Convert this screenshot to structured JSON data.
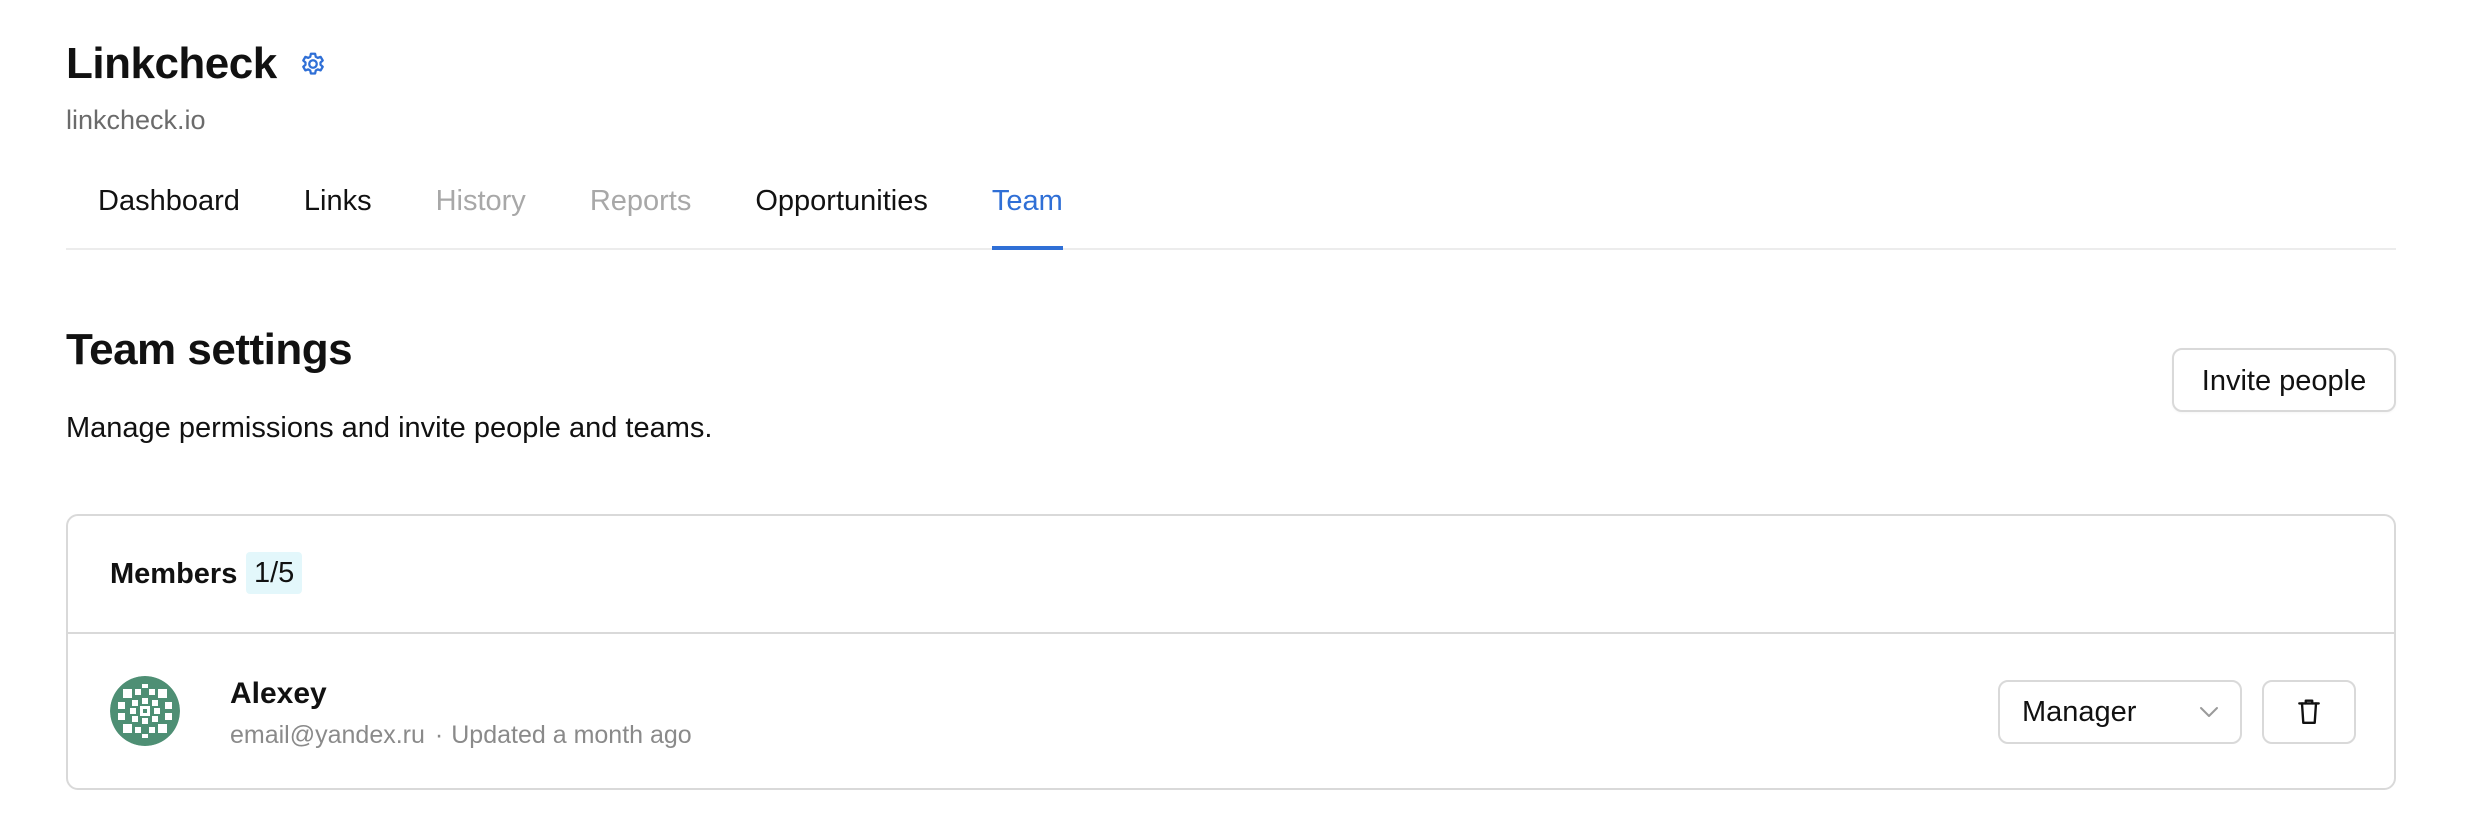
{
  "project": {
    "title": "Linkcheck",
    "domain": "linkcheck.io",
    "settings_icon": "gear-icon"
  },
  "tabs": [
    {
      "label": "Dashboard",
      "state": "normal"
    },
    {
      "label": "Links",
      "state": "normal"
    },
    {
      "label": "History",
      "state": "disabled"
    },
    {
      "label": "Reports",
      "state": "disabled"
    },
    {
      "label": "Opportunities",
      "state": "normal"
    },
    {
      "label": "Team",
      "state": "active"
    }
  ],
  "team": {
    "title": "Team settings",
    "description": "Manage permissions and invite people and teams.",
    "invite_label": "Invite people"
  },
  "members": {
    "title": "Members",
    "count": "1/5",
    "list": [
      {
        "name": "Alexey",
        "email": "email@yandex.ru",
        "separator": "·",
        "updated": "Updated a month ago",
        "role": "Manager",
        "avatar_icon": "identicon-avatar",
        "delete_icon": "trash-icon",
        "role_icon": "chevron-down-icon"
      }
    ]
  },
  "colors": {
    "accent": "#2f6fd6",
    "disabled_text": "#a8a8a8",
    "muted_text": "#8a8a8a",
    "border": "#d9d9d9",
    "count_badge_bg": "#e3f7fb",
    "avatar_green": "#4e8f74"
  }
}
